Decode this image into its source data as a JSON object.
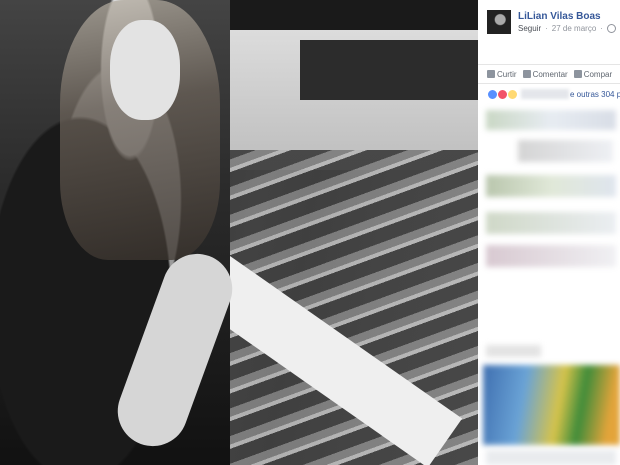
{
  "post": {
    "author": "LiLian Vilas Boas",
    "follow_label": "Seguir",
    "separator": "·",
    "date": "27 de março",
    "privacy_icon": "globe-icon"
  },
  "actions": {
    "like": "Curtir",
    "comment": "Comentar",
    "share": "Compar"
  },
  "reactions": {
    "icons": [
      "like-reaction",
      "love-reaction",
      "wow-reaction"
    ],
    "others_text": "e outras 304 p"
  },
  "colors": {
    "link": "#365899",
    "muted": "#90949c",
    "like": "#5890ff",
    "love": "#f25268",
    "wow": "#ffd972"
  }
}
